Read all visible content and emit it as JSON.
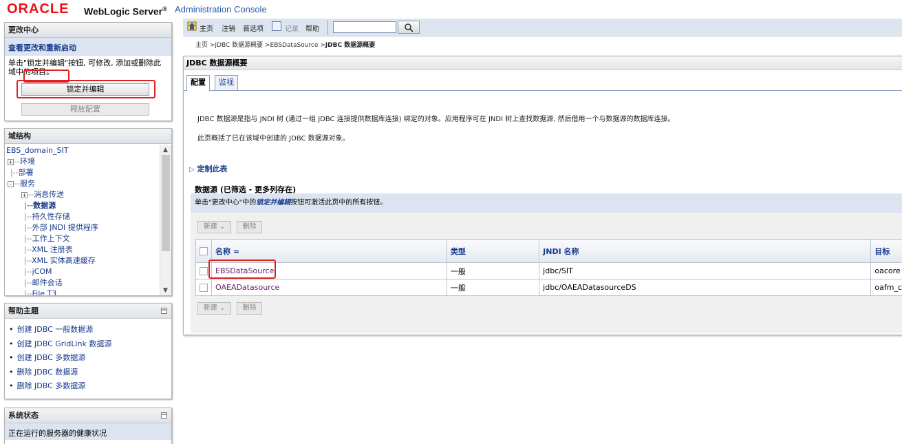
{
  "header": {
    "logo": "ORACLE",
    "product": "WebLogic Server",
    "product_mark": "®",
    "subtitle": "Administration Console"
  },
  "change_center": {
    "title": "更改中心",
    "view_changes_link": "查看更改和重新启动",
    "instructions": "单击\"锁定并编辑\"按钮, 可修改, 添加或删除此域中的项目。",
    "lock_button": "锁定并编辑",
    "release_button": "释放配置"
  },
  "domain_structure": {
    "title": "域结构",
    "root": "EBS_domain_SIT",
    "items": [
      {
        "label": "环境",
        "expander": "+"
      },
      {
        "label": "部署",
        "expander": ""
      },
      {
        "label": "服务",
        "expander": "-"
      },
      {
        "label": "消息传送",
        "expander": "+"
      },
      {
        "label": "数据源",
        "expander": ""
      },
      {
        "label": "持久性存储",
        "expander": ""
      },
      {
        "label": "外部 JNDI 提供程序",
        "expander": ""
      },
      {
        "label": "工作上下文",
        "expander": ""
      },
      {
        "label": "XML 注册表",
        "expander": ""
      },
      {
        "label": "XML 实体高速缓存",
        "expander": ""
      },
      {
        "label": "jCOM",
        "expander": ""
      },
      {
        "label": "邮件会话",
        "expander": ""
      },
      {
        "label": "File T3",
        "expander": ""
      }
    ]
  },
  "help_topics": {
    "title": "帮助主题",
    "collapse_glyph": "⊟",
    "items": [
      "创建 JDBC 一般数据源",
      "创建 JDBC GridLink 数据源",
      "创建 JDBC 多数据源",
      "删除 JDBC 数据源",
      "删除 JDBC 多数据源"
    ]
  },
  "system_status": {
    "title": "系统状态",
    "collapse_glyph": "⊟",
    "subtitle": "正在运行的服务器的健康状况"
  },
  "toolbar": {
    "home": "主页",
    "logout": "注销",
    "preferences": "首选项",
    "record": "记录",
    "help": "帮助",
    "search_value": ""
  },
  "breadcrumb": {
    "part1": "主页 >JDBC 数据源概要 >EBSDataSource >",
    "current": "JDBC 数据源概要"
  },
  "main": {
    "title": "JDBC 数据源概要",
    "tabs": [
      "配置",
      "监视"
    ],
    "description1": "JDBC 数据源是指与 JNDI 树 (通过一组 JDBC 连接提供数据库连接) 绑定的对象。应用程序可在 JNDI 树上查找数据源, 然后借用一个与数据源的数据库连接。",
    "description2": "此页概括了已在该域中创建的 JDBC 数据源对象。",
    "customize_link": "定制此表",
    "datasources_title": "数据源 (已筛选 - 更多列存在)",
    "hint_prefix": "单击\"更改中心\"中的",
    "hint_bold": "锁定并编辑",
    "hint_suffix": "按钮可激活此页中的所有按钮。",
    "new_button": "新建",
    "delete_button": "删除",
    "table": {
      "columns": [
        "名称",
        "类型",
        "JNDI 名称",
        "目标"
      ],
      "sort_glyph": "≈",
      "rows": [
        {
          "name": "EBSDataSource",
          "type": "一般",
          "jndi": "jdbc/SIT",
          "target": "oacore"
        },
        {
          "name": "OAEADatasource",
          "type": "一般",
          "jndi": "jdbc/OAEADatasourceDS",
          "target": "oafm_c"
        }
      ]
    }
  },
  "colors": {
    "brand_red": "#e11111",
    "link_blue": "#173a8c",
    "panel_blue": "#dbe4f0",
    "highlight_red": "#e02020"
  }
}
